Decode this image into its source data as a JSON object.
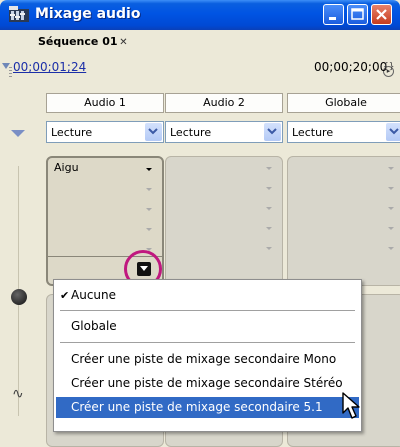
{
  "window": {
    "title": "Mixage audio",
    "app_icon": "audio-mixer-icon",
    "controls": [
      "minimize-icon",
      "maximize-icon",
      "close-icon"
    ]
  },
  "panel": {
    "tab_label": "Séquence 01",
    "tab_close": "✕"
  },
  "timecode": {
    "current": "00;00;01;24",
    "duration": "00;00;20;00"
  },
  "tracks": [
    {
      "name": "Audio 1",
      "mode": "Lecture",
      "effect_slot": "Aigu"
    },
    {
      "name": "Audio 2",
      "mode": "Lecture",
      "effect_slot": ""
    },
    {
      "name": "Globale",
      "mode": "Lecture",
      "effect_slot": ""
    }
  ],
  "menu": {
    "items": [
      {
        "label": "Aucune",
        "checked": true
      },
      {
        "label": "Globale",
        "checked": false
      },
      {
        "label": "Créer une piste de mixage secondaire Mono",
        "checked": false
      },
      {
        "label": "Créer une piste de mixage secondaire Stéréo",
        "checked": false
      },
      {
        "label": "Créer une piste de mixage secondaire 5.1",
        "checked": false,
        "highlighted": true
      }
    ]
  },
  "colors": {
    "titlebar": "#0054e3",
    "highlight": "#316ac5",
    "callout": "#c0187f",
    "timecode_link": "#1c2fa8"
  }
}
